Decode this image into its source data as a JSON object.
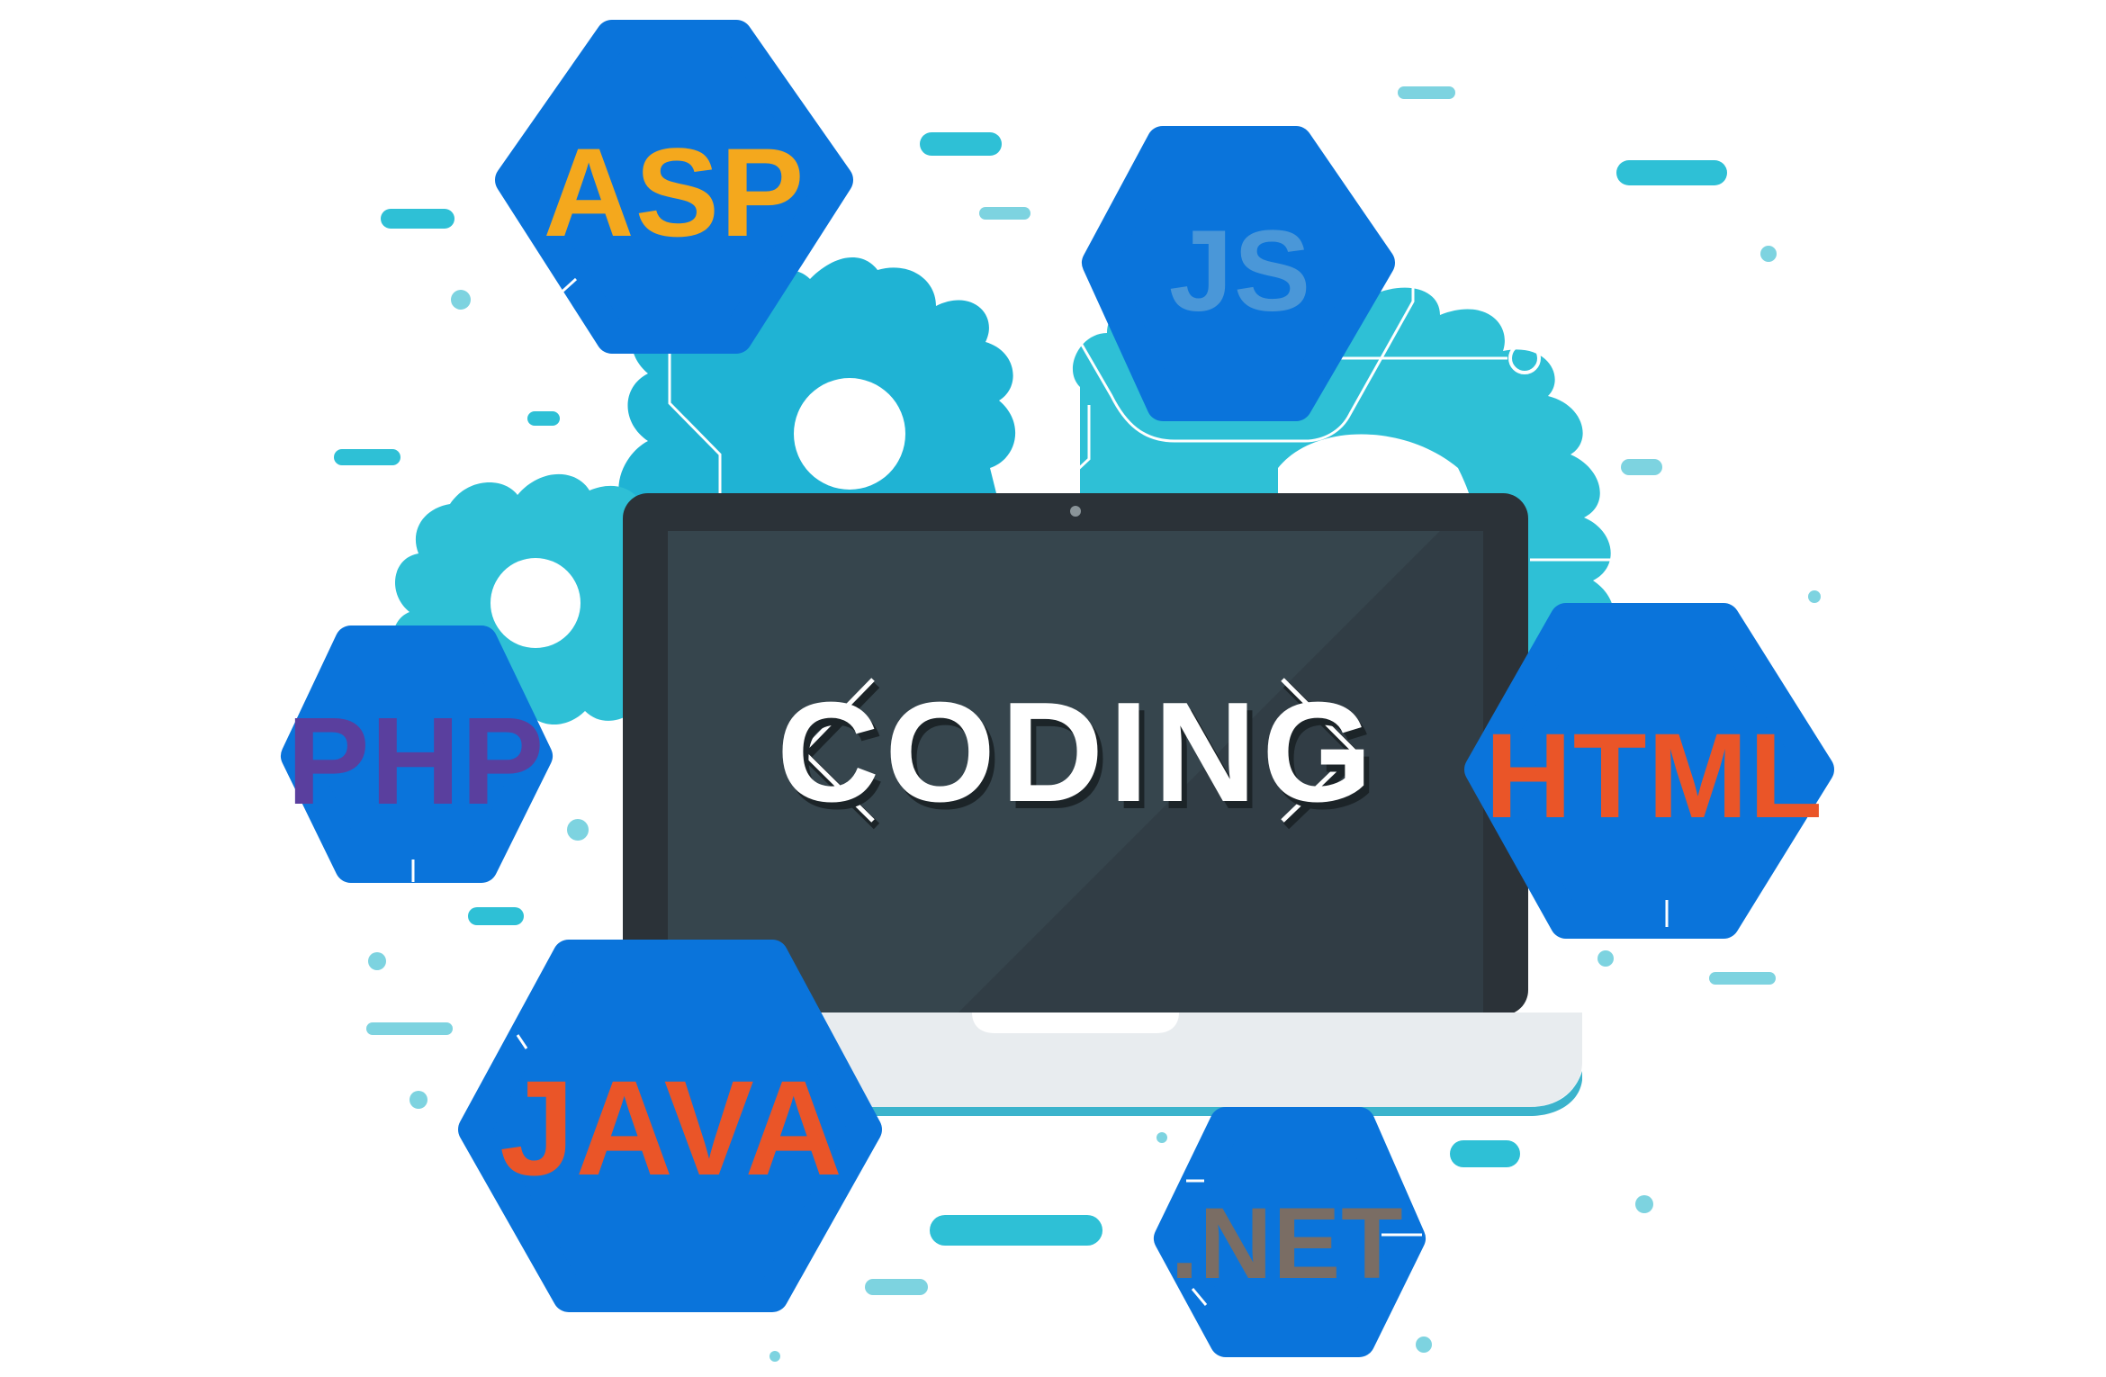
{
  "screen": {
    "title": "CODING"
  },
  "languages": {
    "asp": "ASP",
    "js": "JS",
    "php": "PHP",
    "html": "HTML",
    "java": "JAVA",
    "net": ".NET"
  },
  "colors": {
    "hex_fill": "#0a74db",
    "gear": "#2ec0d6",
    "gear_dark": "#1fb3d4",
    "screen_bezel": "#2b3238",
    "screen_glass": "#36454d",
    "laptop_base": "#e8ecef",
    "base_accent": "#3bb3cc",
    "asp": "#f4a81d",
    "js": "#4a97d8",
    "php": "#5a3f9e",
    "html": "#ea5528",
    "java": "#ea5528",
    "net": "#7a6d64",
    "coding_text": "#ffffff"
  },
  "icons": [
    "gear-icon",
    "laptop-icon",
    "hexagon-badge"
  ]
}
